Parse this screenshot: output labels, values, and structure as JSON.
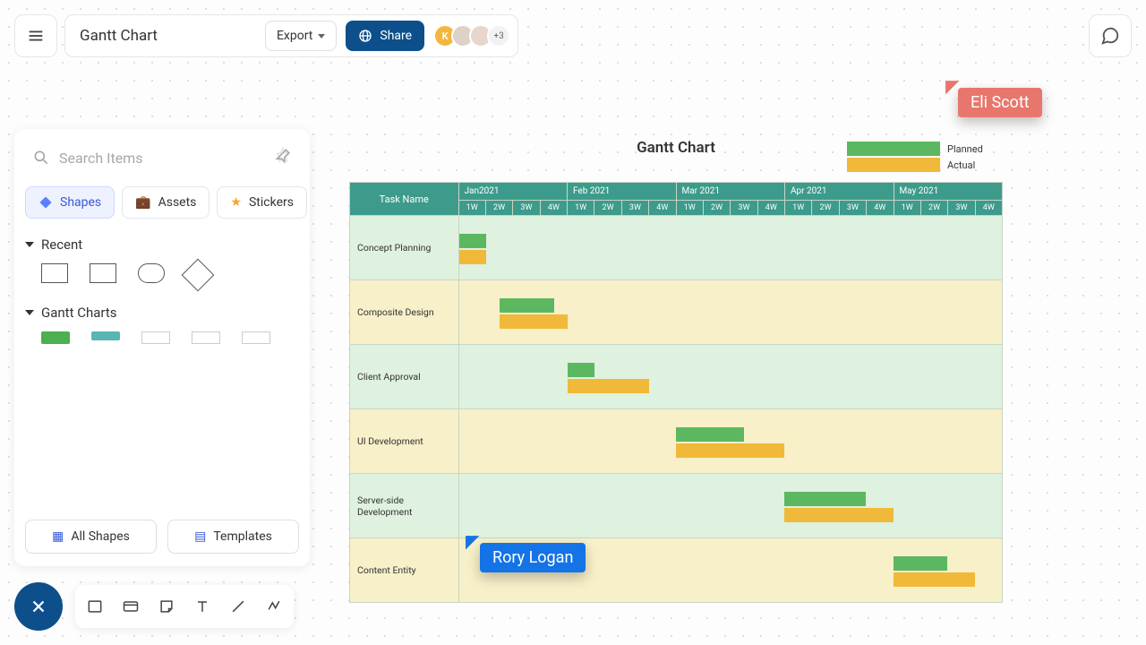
{
  "header": {
    "title": "Gantt Chart",
    "export_label": "Export",
    "share_label": "Share",
    "avatar_letter": "K",
    "avatar_more": "+3"
  },
  "panel": {
    "search_placeholder": "Search Items",
    "tabs": {
      "shapes": "Shapes",
      "assets": "Assets",
      "stickers": "Stickers"
    },
    "section_recent": "Recent",
    "section_gantt": "Gantt Charts",
    "all_shapes": "All Shapes",
    "templates": "Templates"
  },
  "legend": {
    "planned": "Planned",
    "actual": "Actual"
  },
  "cursors": {
    "blue": "Rory Logan",
    "red": "Eli Scott"
  },
  "chart_data": {
    "type": "gantt",
    "title": "Gantt Chart",
    "months": [
      "Jan2021",
      "Feb 2021",
      "Mar 2021",
      "Apr 2021",
      "May 2021"
    ],
    "weeks": [
      "1W",
      "2W",
      "3W",
      "4W"
    ],
    "task_header": "Task Name",
    "tasks": [
      {
        "name": "Concept Planning",
        "planned": {
          "start": 0,
          "span": 1
        },
        "actual": {
          "start": 0,
          "span": 1
        }
      },
      {
        "name": "Composite Design",
        "planned": {
          "start": 1.5,
          "span": 2
        },
        "actual": {
          "start": 1.5,
          "span": 2.5
        }
      },
      {
        "name": "Client Approval",
        "planned": {
          "start": 4,
          "span": 1
        },
        "actual": {
          "start": 4,
          "span": 3
        }
      },
      {
        "name": "UI Development",
        "planned": {
          "start": 8,
          "span": 2.5
        },
        "actual": {
          "start": 8,
          "span": 4
        }
      },
      {
        "name": "Server-side Development",
        "planned": {
          "start": 12,
          "span": 3
        },
        "actual": {
          "start": 12,
          "span": 4
        }
      },
      {
        "name": "Content Entity",
        "planned": {
          "start": 16,
          "span": 2
        },
        "actual": {
          "start": 16,
          "span": 3
        }
      }
    ]
  }
}
